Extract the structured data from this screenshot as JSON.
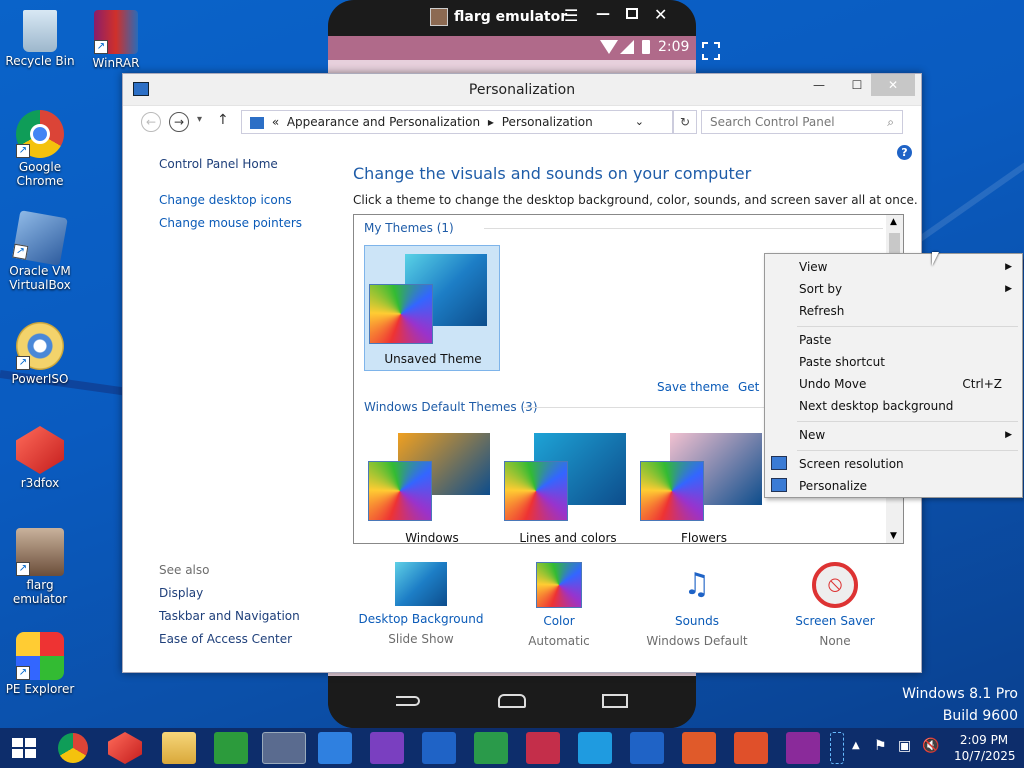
{
  "desktop": {
    "icons": [
      {
        "label": "Recycle Bin"
      },
      {
        "label": "WinRAR"
      },
      {
        "label": "Google Chrome"
      },
      {
        "label": "Oracle VM VirtualBox"
      },
      {
        "label": "PowerISO"
      },
      {
        "label": "r3dfox"
      },
      {
        "label": "flarg emulator"
      },
      {
        "label": "PE Explorer"
      }
    ],
    "watermark": {
      "line1": "Windows 8.1 Pro",
      "line2": "Build 9600"
    }
  },
  "emulator": {
    "title": "flarg emulator",
    "time": "2:09"
  },
  "window": {
    "title": "Personalization",
    "breadcrumb": {
      "prefix": "«",
      "part1": "Appearance and Personalization",
      "part2": "Personalization"
    },
    "search_placeholder": "Search Control Panel",
    "left": {
      "home": "Control Panel Home",
      "links": [
        "Change desktop icons",
        "Change mouse pointers"
      ],
      "see_also": "See also",
      "see_links": [
        "Display",
        "Taskbar and Navigation",
        "Ease of Access Center"
      ]
    },
    "heading": "Change the visuals and sounds on your computer",
    "subheading": "Click a theme to change the desktop background, color, sounds, and screen saver all at once.",
    "my_themes": "My Themes (1)",
    "unsaved_theme": "Unsaved Theme",
    "save_theme": "Save theme",
    "get_more": "Get m",
    "default_themes": "Windows Default Themes (3)",
    "themes": [
      {
        "name": "Windows",
        "color": "#f0a020"
      },
      {
        "name": "Lines and colors",
        "color": "#1ea3d6"
      },
      {
        "name": "Flowers",
        "color": "#f2c1d0"
      }
    ],
    "bottom": [
      {
        "title": "Desktop Background",
        "value": "Slide Show"
      },
      {
        "title": "Color",
        "value": "Automatic"
      },
      {
        "title": "Sounds",
        "value": "Windows Default"
      },
      {
        "title": "Screen Saver",
        "value": "None"
      }
    ]
  },
  "context_menu": {
    "view": "View",
    "sort_by": "Sort by",
    "refresh": "Refresh",
    "paste": "Paste",
    "paste_shortcut": "Paste shortcut",
    "undo_move": "Undo Move",
    "undo_shortcut": "Ctrl+Z",
    "next_bg": "Next desktop background",
    "new": "New",
    "screen_resolution": "Screen resolution",
    "personalize": "Personalize"
  },
  "taskbar": {
    "time": "2:09 PM",
    "date": "10/7/2025"
  },
  "colors": {
    "accent": "#0b5bb8",
    "taskbar": "#0d2d6b",
    "desktop": "#0a5bc0"
  }
}
